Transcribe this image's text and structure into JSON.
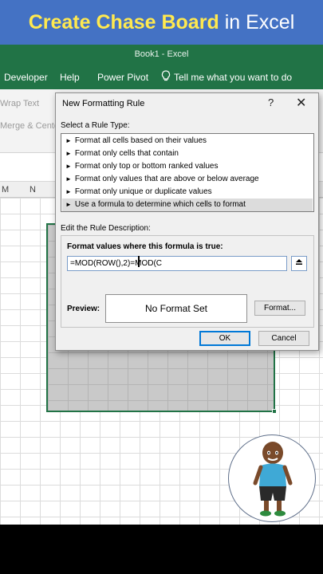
{
  "banner": {
    "part1": "Create Chase Board",
    "part2": "in Excel"
  },
  "window": {
    "title": "Book1  -  Excel"
  },
  "tabs": [
    {
      "label": "Developer"
    },
    {
      "label": "Help"
    },
    {
      "label": "Power Pivot"
    },
    {
      "label": "Tell me what you want to do"
    }
  ],
  "ribbon": {
    "wrap_text": "Wrap Text",
    "merge_center": "Merge & Center"
  },
  "columns": [
    "M",
    "N"
  ],
  "dialog": {
    "title": "New Formatting Rule",
    "help": "?",
    "close": "✕",
    "select_rule_type_label": "Select a Rule Type:",
    "rule_types": [
      "Format all cells based on their values",
      "Format only cells that contain",
      "Format only top or bottom ranked values",
      "Format only values that are above or below average",
      "Format only unique or duplicate values",
      "Use a formula to determine which cells to format"
    ],
    "selected_rule_index": 5,
    "edit_description_label": "Edit the Rule Description:",
    "formula_label": "Format values where this formula is true:",
    "formula_value": "=MOD(ROW(),2)=MOD(C",
    "preview_label": "Preview:",
    "preview_text": "No Format Set",
    "format_button": "Format...",
    "ok_button": "OK",
    "cancel_button": "Cancel"
  },
  "colors": {
    "banner_bg": "#4472c4",
    "banner_accent": "#ffe94f",
    "excel_green": "#217346",
    "selection_fill": "#c9c9c9"
  }
}
